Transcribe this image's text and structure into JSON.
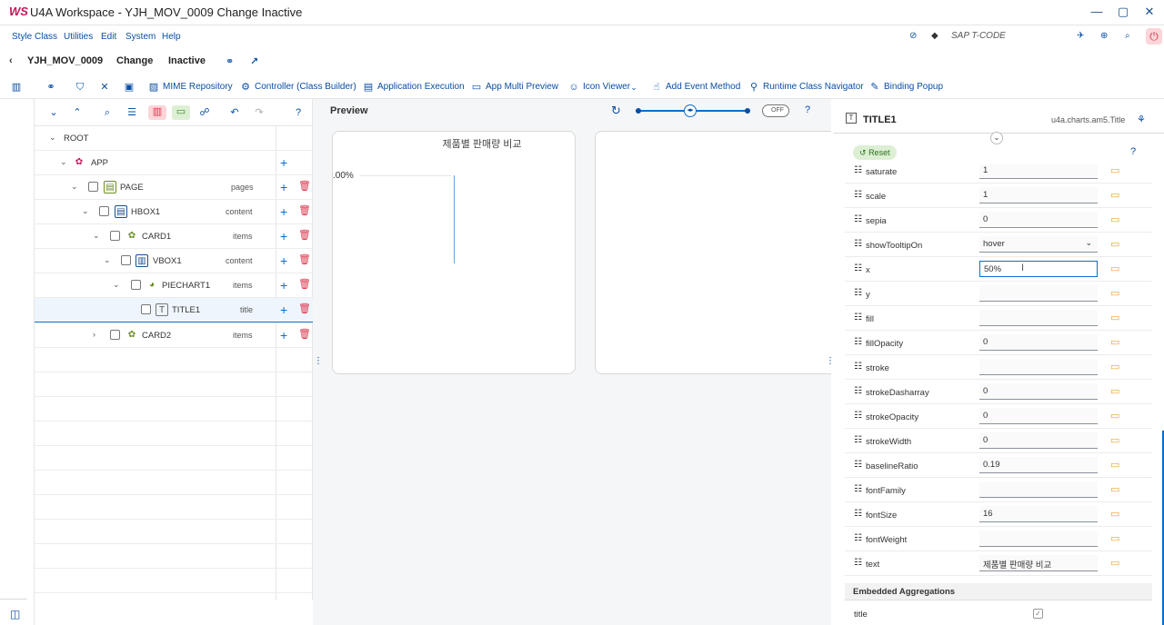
{
  "window": {
    "logo": "WS",
    "title": "U4A Workspace - YJH_MOV_0009 Change Inactive",
    "controls": [
      "—",
      "▢",
      "✕"
    ]
  },
  "menubar": {
    "items": [
      "Style Class",
      "Utilities",
      "Edit",
      "System",
      "Help"
    ],
    "tcode_placeholder": "SAP T-CODE"
  },
  "header": {
    "app_id": "YJH_MOV_0009",
    "mode": "Change",
    "status": "Inactive"
  },
  "toolbar": {
    "items": [
      "MIME Repository",
      "Controller (Class Builder)",
      "Application Execution",
      "App Multi Preview",
      "Icon Viewer",
      "Add Event Method",
      "Runtime Class Navigator",
      "Binding Popup"
    ]
  },
  "tree": {
    "nodes": [
      {
        "label": "ROOT",
        "agg": "",
        "level": 0
      },
      {
        "label": "APP",
        "agg": "",
        "level": 1
      },
      {
        "label": "PAGE",
        "agg": "pages",
        "level": 2
      },
      {
        "label": "HBOX1",
        "agg": "content",
        "level": 3
      },
      {
        "label": "CARD1",
        "agg": "items",
        "level": 4
      },
      {
        "label": "VBOX1",
        "agg": "content",
        "level": 5
      },
      {
        "label": "PIECHART1",
        "agg": "items",
        "level": 6
      },
      {
        "label": "TITLE1",
        "agg": "title",
        "level": 7
      },
      {
        "label": "CARD2",
        "agg": "items",
        "level": 4
      }
    ]
  },
  "preview": {
    "title": "Preview",
    "toggle": "OFF",
    "chart_title": "제품별 판매량 비교",
    "axis_label": ".00%"
  },
  "props": {
    "element": "TITLE1",
    "class": "u4a.charts.am5.Title",
    "reset": "Reset",
    "rows": [
      {
        "label": "saturate",
        "value": "1"
      },
      {
        "label": "scale",
        "value": "1"
      },
      {
        "label": "sepia",
        "value": "0"
      },
      {
        "label": "showTooltipOn",
        "value": "hover"
      },
      {
        "label": "x",
        "value": "50%"
      },
      {
        "label": "y",
        "value": ""
      },
      {
        "label": "fill",
        "value": ""
      },
      {
        "label": "fillOpacity",
        "value": "0"
      },
      {
        "label": "stroke",
        "value": ""
      },
      {
        "label": "strokeDasharray",
        "value": "0"
      },
      {
        "label": "strokeOpacity",
        "value": "0"
      },
      {
        "label": "strokeWidth",
        "value": "0"
      },
      {
        "label": "baselineRatio",
        "value": "0.19"
      },
      {
        "label": "fontFamily",
        "value": ""
      },
      {
        "label": "fontSize",
        "value": "16"
      },
      {
        "label": "fontWeight",
        "value": ""
      },
      {
        "label": "text",
        "value": "제품별 판매량 비교"
      }
    ],
    "embedded_title": "Embedded Aggregations",
    "embedded_row": "title"
  }
}
